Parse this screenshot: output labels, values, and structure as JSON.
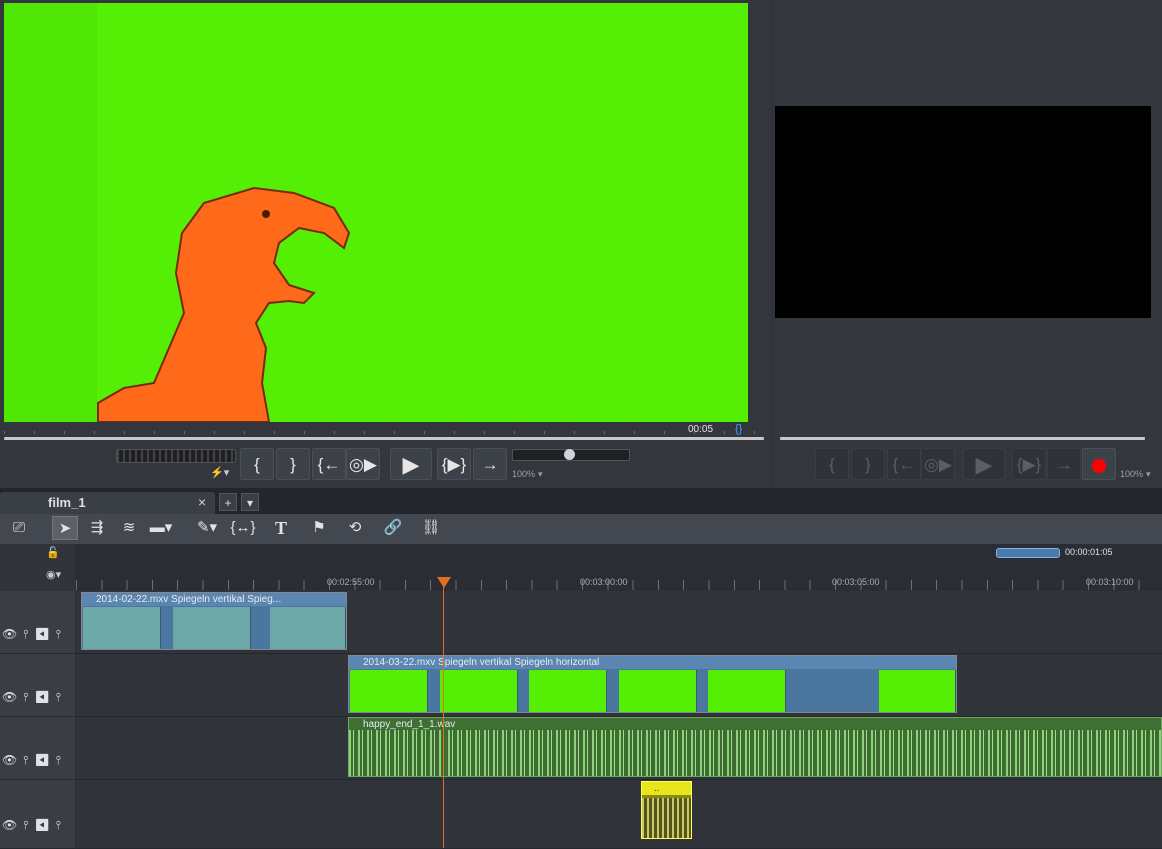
{
  "player_left": {
    "timecode": "00:05",
    "speed_icon": "lightning-icon",
    "zoom": "100%",
    "controls": [
      "{",
      "}",
      "{←",
      "◎▶",
      "▶",
      "{▶}",
      "→"
    ]
  },
  "player_right": {
    "zoom": "100%",
    "controls": [
      "{",
      "}",
      "{←",
      "◎▶",
      "▶",
      "{▶}",
      "→"
    ]
  },
  "tabs": {
    "active": "film_1",
    "close": "×",
    "add": "+",
    "menu": "▾"
  },
  "toolbar": {
    "tools": [
      "pointer-icon",
      "ripple-icon",
      "ripple-all-icon",
      "track-icon",
      "blade-icon",
      "range-icon",
      "text-icon",
      "marker-icon",
      "undo-icon",
      "link-icon",
      "unlink-icon"
    ]
  },
  "timeline": {
    "range_duration": "00:00:01:05",
    "ruler": [
      "00:02:55:00",
      "00:03:00:00",
      "00:03:05:00",
      "00:03:10:00"
    ],
    "clips": [
      {
        "track": 1,
        "title": "2014-02-22.mxv  Spiegeln vertikal  Spieg..."
      },
      {
        "track": 2,
        "title": "2014-03-22.mxv  Spiegeln vertikal  Spiegeln horizontal"
      },
      {
        "track": 3,
        "title": "happy_end_1_1.wav"
      },
      {
        "track": 4,
        "title": ".."
      }
    ]
  },
  "colors": {
    "greenscreen": "#55ee05",
    "playhead": "#e0701c",
    "record": "#ff0000",
    "audio_clip": "#3d6b32",
    "video_clip_header": "#4a76a0"
  }
}
